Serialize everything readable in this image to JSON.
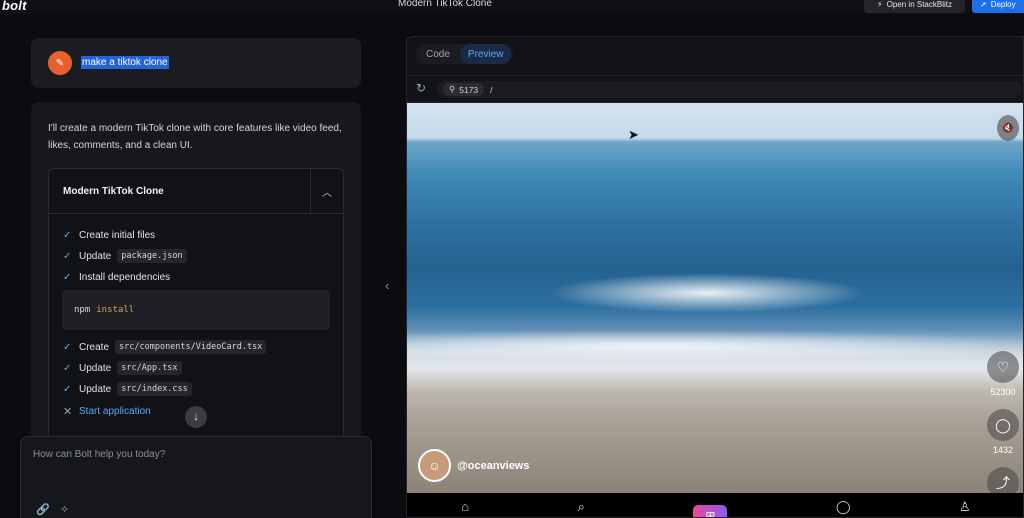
{
  "app": {
    "logo": "bolt",
    "title": "Modern TikTok Clone"
  },
  "header": {
    "stackblitz_label": "Open in StackBlitz",
    "deploy_label": "Deploy"
  },
  "chat": {
    "user_message": "make a tiktok clone",
    "assistant_message": "I'll create a modern TikTok clone with core features like video feed, likes, comments, and a clean UI.",
    "artifact": {
      "title": "Modern TikTok Clone",
      "steps": [
        {
          "label": "Create initial files",
          "code": "",
          "status": "done"
        },
        {
          "label": "Update",
          "code": "package.json",
          "status": "done"
        },
        {
          "label": "Install dependencies",
          "code": "",
          "status": "done"
        },
        {
          "label": "Create",
          "code": "src/components/VideoCard.tsx",
          "status": "done"
        },
        {
          "label": "Update",
          "code": "src/App.tsx",
          "status": "done"
        },
        {
          "label": "Update",
          "code": "src/index.css",
          "status": "done"
        },
        {
          "label": "Start application",
          "code": "",
          "status": "failed"
        }
      ],
      "command": {
        "cmd": "npm",
        "arg": "install"
      }
    },
    "prompt_placeholder": "How can Bolt help you today?"
  },
  "preview": {
    "tabs": [
      {
        "label": "Code",
        "active": false
      },
      {
        "label": "Preview",
        "active": true
      }
    ],
    "port": "5173",
    "path": "/",
    "video": {
      "username": "@oceanviews",
      "likes": "52300",
      "comments": "1432"
    }
  },
  "colors": {
    "accent": "#1f6feb",
    "check": "#60a5fa",
    "selection": "#2563d6"
  }
}
